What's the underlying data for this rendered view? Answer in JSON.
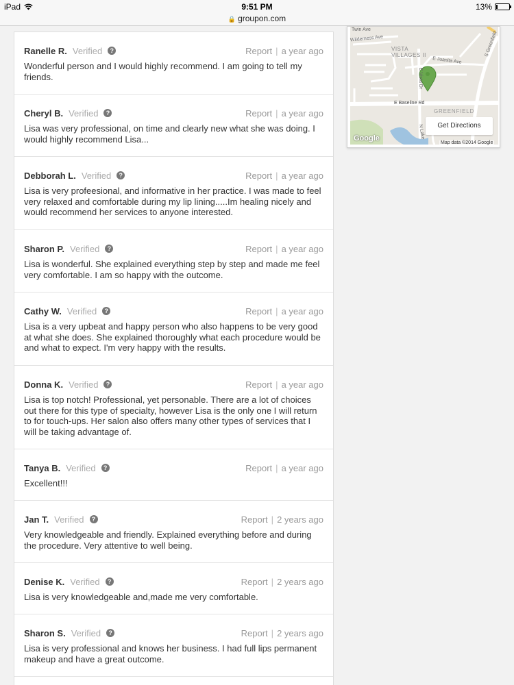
{
  "status_bar": {
    "device": "iPad",
    "time": "9:51 PM",
    "battery": "13%",
    "battery_level": 0.13
  },
  "url_bar": {
    "domain": "groupon.com"
  },
  "reviews": [
    {
      "name": "Ranelle R.",
      "verified": "Verified",
      "report": "Report",
      "time": "a year ago",
      "text": "Wonderful person and I would highly recommend. I am going to tell my friends."
    },
    {
      "name": "Cheryl B.",
      "verified": "Verified",
      "report": "Report",
      "time": "a year ago",
      "text": "Lisa was very professional, on time and clearly new what she was doing. I would highly recommend Lisa..."
    },
    {
      "name": "Debborah L.",
      "verified": "Verified",
      "report": "Report",
      "time": "a year ago",
      "text": "Lisa is very profeesional, and informative in her practice. I was made to feel very relaxed and comfortable during my lip lining.....Im healing nicely and would recommend her services to anyone interested."
    },
    {
      "name": "Sharon P.",
      "verified": "Verified",
      "report": "Report",
      "time": "a year ago",
      "text": "Lisa is wonderful. She explained everything step by step and made me feel very comfortable. I am so happy with the outcome."
    },
    {
      "name": "Cathy W.",
      "verified": "Verified",
      "report": "Report",
      "time": "a year ago",
      "text": "Lisa is a very upbeat and happy person who also happens to be very good at what she does. She explained thoroughly what each procedure would be and what to expect. I'm very happy with the results."
    },
    {
      "name": "Donna K.",
      "verified": "Verified",
      "report": "Report",
      "time": "a year ago",
      "text": "Lisa is top notch! Professional, yet personable. There are a lot of choices out there for this type of specialty, however Lisa is the only one I will return to for touch-ups. Her salon also offers many other types of services that I will be taking advantage of."
    },
    {
      "name": "Tanya B.",
      "verified": "Verified",
      "report": "Report",
      "time": "a year ago",
      "text": "Excellent!!!"
    },
    {
      "name": "Jan T.",
      "verified": "Verified",
      "report": "Report",
      "time": "2 years ago",
      "text": "Very knowledgeable and friendly. Explained everything before and during the procedure. Very attentive to well being."
    },
    {
      "name": "Denise K.",
      "verified": "Verified",
      "report": "Report",
      "time": "2 years ago",
      "text": "Lisa is very knowledgeable and,made me very comfortable."
    },
    {
      "name": "Sharon S.",
      "verified": "Verified",
      "report": "Report",
      "time": "2 years ago",
      "text": "Lisa is very professional and knows her business. I had full lips permanent makeup and have a great outcome."
    }
  ],
  "map": {
    "labels": {
      "twin_ave": "Twin Ave",
      "wilderness_ave": "Wilderness Ave",
      "vista_villages": "VISTA VILLAGES II",
      "juanita_ave": "E Juanita Ave",
      "greenfield_rd": "S Greenfield",
      "baseline_rd": "E Baseline Rd",
      "greenfield_area": "GREENFIELD",
      "n_lake_dr": "N Lake",
      "e_vista_dr": "E Vista Dr"
    },
    "directions_label": "Get Directions",
    "google_logo": "Google",
    "map_data": "Map data ©2014 Google",
    "pin_color": "#6aa84f"
  }
}
